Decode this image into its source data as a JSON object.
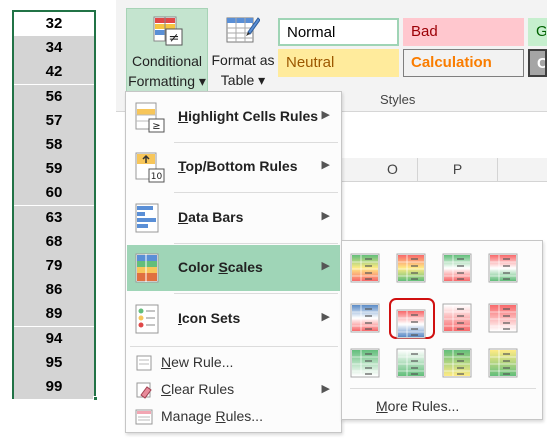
{
  "column_values": [
    "32",
    "34",
    "42",
    "56",
    "57",
    "58",
    "59",
    "60",
    "63",
    "68",
    "79",
    "86",
    "89",
    "94",
    "95",
    "99"
  ],
  "ribbon": {
    "conditional_formatting": {
      "line1": "Conditional",
      "line2": "Formatting ▾"
    },
    "format_as_table": {
      "line1": "Format as",
      "line2": "Table ▾"
    },
    "styles": {
      "normal": "Normal",
      "bad": "Bad",
      "good": "G",
      "neutral": "Neutral",
      "calculation": "Calculation",
      "check": "C"
    },
    "group_label": "Styles"
  },
  "grid": {
    "columns": [
      "O",
      "P"
    ]
  },
  "menu": {
    "items": [
      {
        "label": "Highlight Cells Rules",
        "accel": "H",
        "rest": "ighlight Cells Rules",
        "icon": "highlight-cells-icon"
      },
      {
        "label": "Top/Bottom Rules",
        "accel": "T",
        "rest": "op/Bottom Rules",
        "icon": "top-bottom-icon"
      },
      {
        "label": "Data Bars",
        "accel": "D",
        "rest": "ata Bars",
        "icon": "data-bars-icon"
      },
      {
        "label": "Color Scales",
        "accel": "S",
        "pre": "Color ",
        "rest": "cales",
        "icon": "color-scales-icon"
      },
      {
        "label": "Icon Sets",
        "accel": "I",
        "rest": "con Sets",
        "icon": "icon-sets-icon"
      }
    ],
    "new_rule": {
      "accel": "N",
      "rest": "ew Rule..."
    },
    "clear_rules": {
      "accel": "C",
      "rest": "lear Rules"
    },
    "manage_rules": {
      "pre": "Manage ",
      "accel": "R",
      "rest": "ules..."
    }
  },
  "color_scales": {
    "scales": [
      [
        "green-yellow-red",
        "red-yellow-green",
        "green-white-red",
        "red-white-green"
      ],
      [
        "blue-white-red",
        "red-white-blue",
        "white-red",
        "red-white"
      ],
      [
        "green-white",
        "white-green",
        "green-yellow",
        "yellow-green"
      ]
    ],
    "selected": "red-white-blue",
    "more_rules": {
      "accel": "M",
      "rest": "ore Rules..."
    }
  },
  "colors": {
    "accent_green": "#217346",
    "highlight": "#9fd5b7",
    "selection_ring": "#d01010"
  }
}
